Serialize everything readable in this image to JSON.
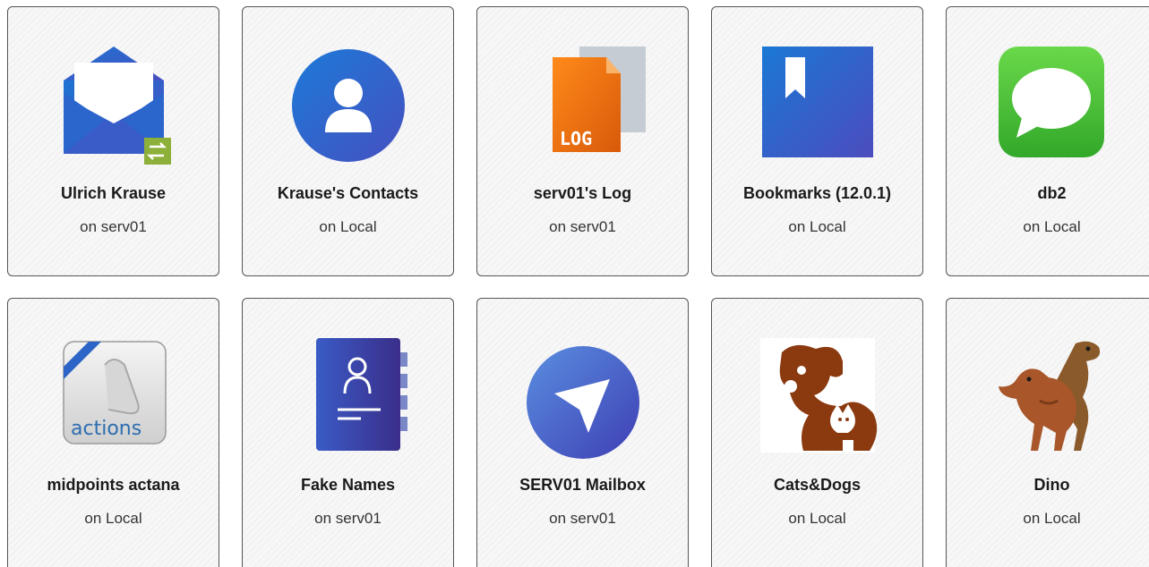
{
  "tiles": [
    {
      "title": "Ulrich Krause",
      "subtitle": "on serv01",
      "icon": "mail-sync-icon"
    },
    {
      "title": "Krause's Contacts",
      "subtitle": "on Local",
      "icon": "contact-person-icon"
    },
    {
      "title": "serv01's Log",
      "subtitle": "on serv01",
      "icon": "log-file-icon",
      "icon_text": "LOG"
    },
    {
      "title": "Bookmarks (12.0.1)",
      "subtitle": "on Local",
      "icon": "bookmark-book-icon"
    },
    {
      "title": "db2",
      "subtitle": "on Local",
      "icon": "chat-bubble-icon"
    },
    {
      "title": "midpoints actana",
      "subtitle": "on Local",
      "icon": "actions-scroll-icon",
      "icon_text": "actions"
    },
    {
      "title": "Fake Names",
      "subtitle": "on serv01",
      "icon": "address-book-icon"
    },
    {
      "title": "SERV01 Mailbox",
      "subtitle": "on serv01",
      "icon": "send-paper-plane-icon"
    },
    {
      "title": "Cats&Dogs",
      "subtitle": "on Local",
      "icon": "cat-dog-icon"
    },
    {
      "title": "Dino",
      "subtitle": "on Local",
      "icon": "dinosaur-icon"
    }
  ],
  "colors": {
    "tile_border": "#555555",
    "tile_bg": "#f7f7f7",
    "blue_gradient_start": "#1f6fd0",
    "blue_gradient_end": "#4a4fc0",
    "log_orange": "#f07a10",
    "chat_green": "#4cc23a",
    "brown": "#8b3a10"
  }
}
